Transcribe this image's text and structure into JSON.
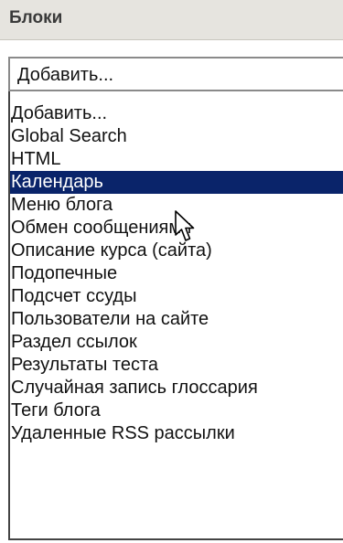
{
  "block": {
    "title": "Блоки"
  },
  "select": {
    "value": "Добавить..."
  },
  "dropdown": {
    "items": [
      {
        "label": "Добавить..."
      },
      {
        "label": "Global Search"
      },
      {
        "label": "HTML"
      },
      {
        "label": "Календарь"
      },
      {
        "label": "Меню блога"
      },
      {
        "label": "Обмен сообщениями"
      },
      {
        "label": "Описание курса (сайта)"
      },
      {
        "label": "Подопечные"
      },
      {
        "label": "Подсчет ссуды"
      },
      {
        "label": "Пользователи на сайте"
      },
      {
        "label": "Раздел ссылок"
      },
      {
        "label": "Результаты теста"
      },
      {
        "label": "Случайная запись глоссария"
      },
      {
        "label": "Теги блога"
      },
      {
        "label": "Удаленные RSS рассылки"
      }
    ],
    "selected_index": 3
  },
  "colors": {
    "header_bg": "#e6e4df",
    "selection_bg": "#0a246a",
    "selection_text": "#ffffff"
  },
  "icons": {
    "cursor": "mouse-pointer-icon"
  }
}
